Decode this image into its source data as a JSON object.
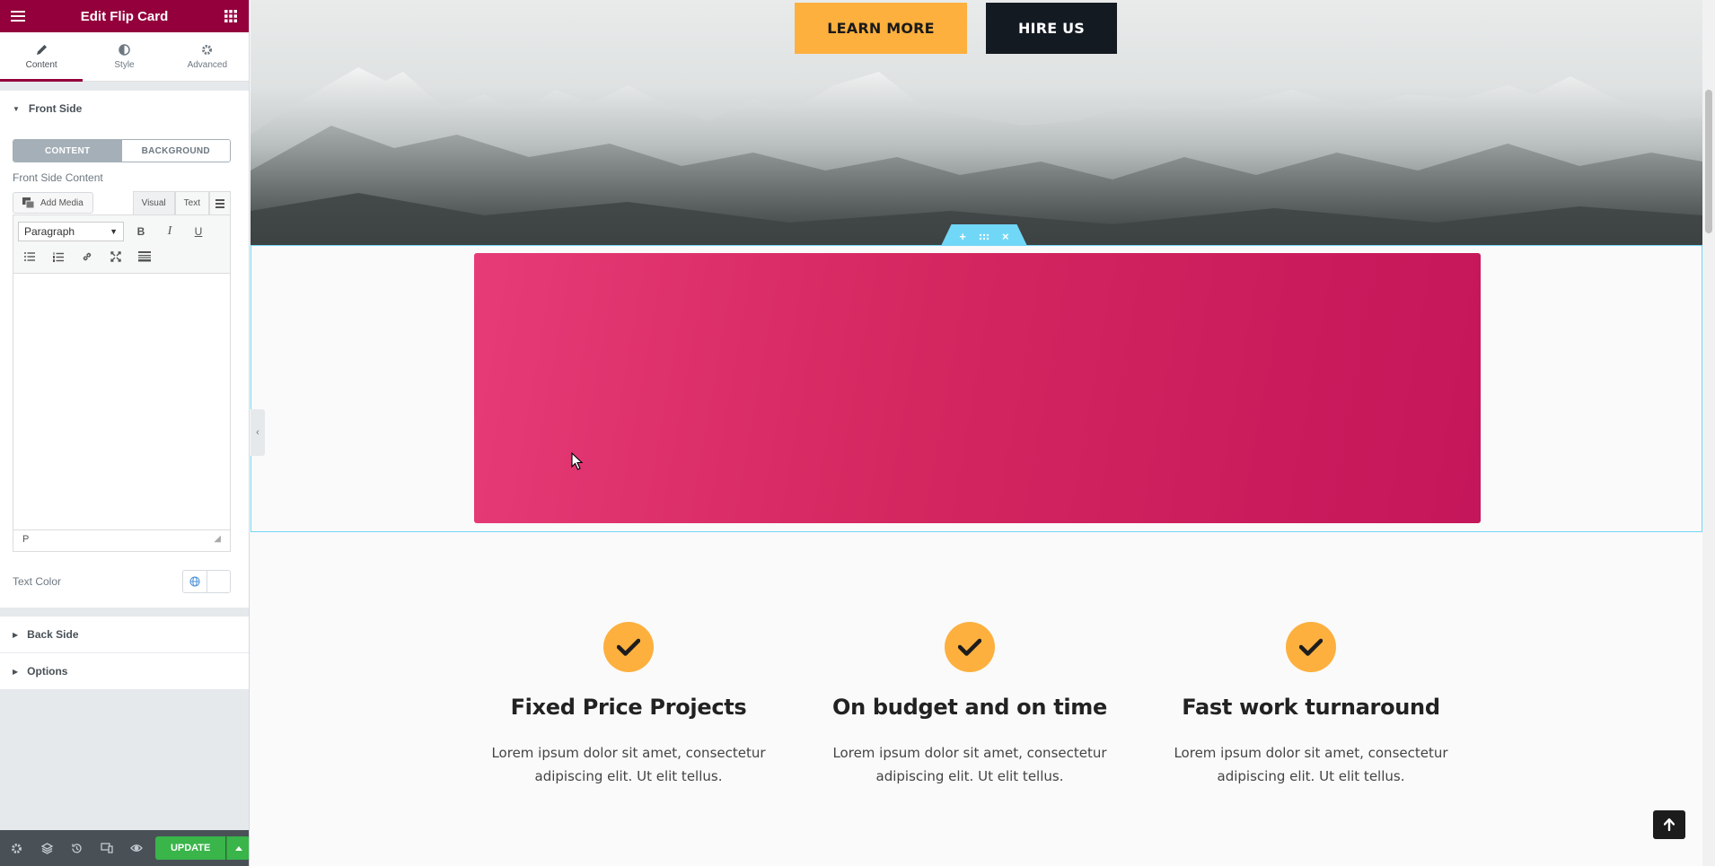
{
  "panel": {
    "title": "Edit Flip Card",
    "tabs": [
      {
        "label": "Content",
        "icon": "pencil-icon"
      },
      {
        "label": "Style",
        "icon": "half-circle-icon"
      },
      {
        "label": "Advanced",
        "icon": "gear-icon"
      }
    ],
    "active_tab": "Content",
    "front_side": {
      "heading": "Front Side",
      "switcher": [
        "CONTENT",
        "BACKGROUND"
      ],
      "active_switch": "CONTENT",
      "content_label": "Front Side Content",
      "add_media": "Add Media",
      "editor_tabs": [
        "Visual",
        "Text"
      ],
      "format_select": "Paragraph",
      "toolbar_bold": "B",
      "toolbar_italic": "I",
      "toolbar_underline": "U",
      "path": "P",
      "text_color_label": "Text Color"
    },
    "back_side": "Back Side",
    "options": "Options",
    "footer": {
      "update": "UPDATE"
    },
    "accent": "#93003c"
  },
  "hero": {
    "learn_more": "LEARN MORE",
    "hire_us": "HIRE US"
  },
  "flip_card": {
    "color_start": "#e63b77",
    "color_end": "#c4165a"
  },
  "features": [
    {
      "title": "Fixed Price Projects",
      "text_line1": "Lorem ipsum dolor sit amet, consectetur",
      "text_line2": "adipiscing elit. Ut elit tellus."
    },
    {
      "title": "On budget and on time",
      "text_line1": "Lorem ipsum dolor sit amet, consectetur",
      "text_line2": "adipiscing elit. Ut elit tellus."
    },
    {
      "title": "Fast work turnaround",
      "text_line1": "Lorem ipsum dolor sit amet, consectetur",
      "text_line2": "adipiscing elit. Ut elit tellus."
    }
  ],
  "colors": {
    "orange": "#fdb03e",
    "dark": "#141a22",
    "update_green": "#39b54a",
    "selection": "#71d7f7"
  }
}
